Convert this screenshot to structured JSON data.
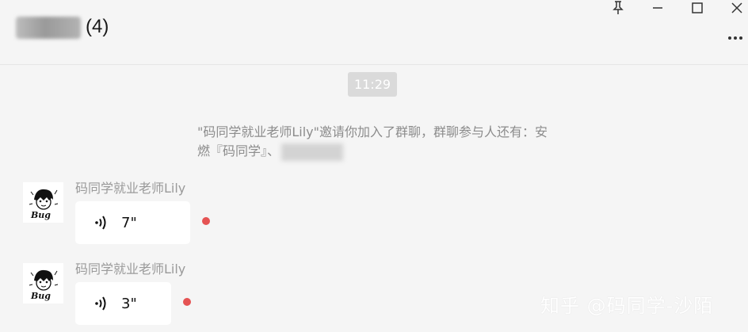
{
  "header": {
    "member_count": "(4)"
  },
  "window_controls": {
    "pin": "pin-icon",
    "minimize": "minimize-icon",
    "maximize": "maximize-icon",
    "close": "close-icon",
    "more": "more-icon"
  },
  "chat": {
    "timestamp": "11:29",
    "system_message": "\"码同学就业老师Lily\"邀请你加入了群聊，群聊参与人还有：安燃『码同学』、",
    "messages": [
      {
        "sender": "码同学就业老师Lily",
        "type": "voice",
        "duration": "7\"",
        "unread": true
      },
      {
        "sender": "码同学就业老师Lily",
        "type": "voice",
        "duration": "3\"",
        "unread": true
      }
    ]
  },
  "colors": {
    "background": "#f5f5f5",
    "bubble": "#ffffff",
    "unread_dot": "#e55353",
    "timestamp_badge": "#dadada"
  },
  "watermark": "知乎 @码同学-沙陌"
}
